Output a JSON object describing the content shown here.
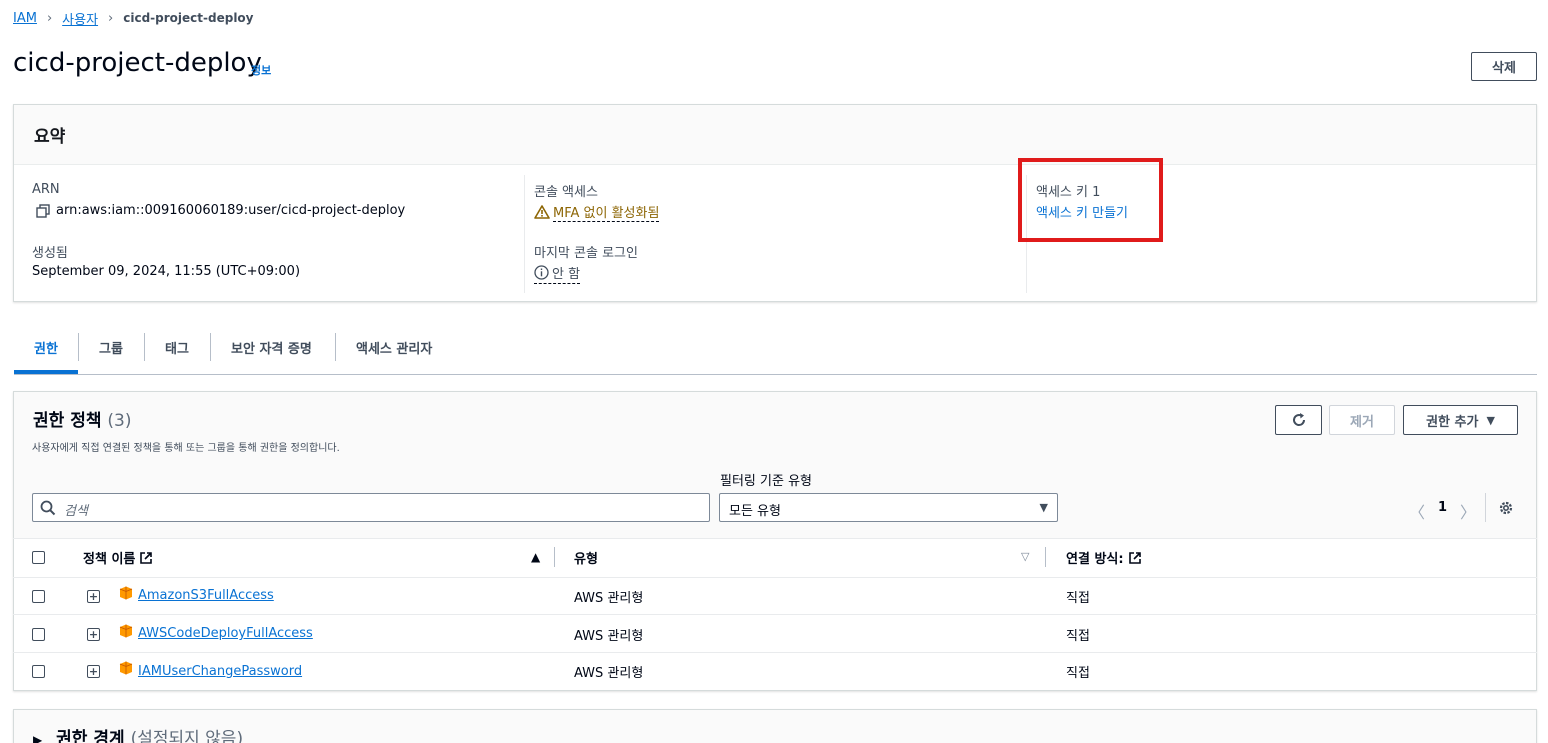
{
  "breadcrumb": {
    "root": "IAM",
    "parent": "사용자",
    "current": "cicd-project-deploy"
  },
  "page": {
    "title": "cicd-project-deploy",
    "info": "정보",
    "delete_button": "삭제"
  },
  "summary": {
    "title": "요약",
    "arn_label": "ARN",
    "arn_value": "arn:aws:iam::009160060189:user/cicd-project-deploy",
    "created_label": "생성됨",
    "created_value": "September 09, 2024, 11:55 (UTC+09:00)",
    "console_access_label": "콘솔 액세스",
    "console_access_value": "MFA 없이 활성화됨",
    "last_login_label": "마지막 콘솔 로그인",
    "last_login_value": "안 함",
    "access_key_label": "액세스 키 1",
    "access_key_link": "액세스 키 만들기"
  },
  "tabs": [
    {
      "label": "권한",
      "active": true
    },
    {
      "label": "그룹",
      "active": false
    },
    {
      "label": "태그",
      "active": false
    },
    {
      "label": "보안 자격 증명",
      "active": false
    },
    {
      "label": "액세스 관리자",
      "active": false
    }
  ],
  "permissions": {
    "title": "권한 정책",
    "count": "(3)",
    "description": "사용자에게 직접 연결된 정책을 통해 또는 그룹을 통해 권한을 정의합니다.",
    "remove_button": "제거",
    "add_button": "권한 추가",
    "search_placeholder": "검색",
    "filter_label": "필터링 기준 유형",
    "filter_value": "모든 유형",
    "page_number": "1",
    "columns": {
      "name": "정책 이름",
      "type": "유형",
      "attached": "연결 방식:"
    },
    "rows": [
      {
        "name": "AmazonS3FullAccess",
        "type": "AWS 관리형",
        "attached": "직접"
      },
      {
        "name": "AWSCodeDeployFullAccess",
        "type": "AWS 관리형",
        "attached": "직접"
      },
      {
        "name": "IAMUserChangePassword",
        "type": "AWS 관리형",
        "attached": "직접"
      }
    ]
  },
  "boundary": {
    "title": "권한 경계",
    "status": "(설정되지 않음)"
  },
  "colors": {
    "link": "#0972d3",
    "warning": "#8d6605",
    "highlight": "#e01b1b",
    "aws_orange": "#ff9900"
  }
}
